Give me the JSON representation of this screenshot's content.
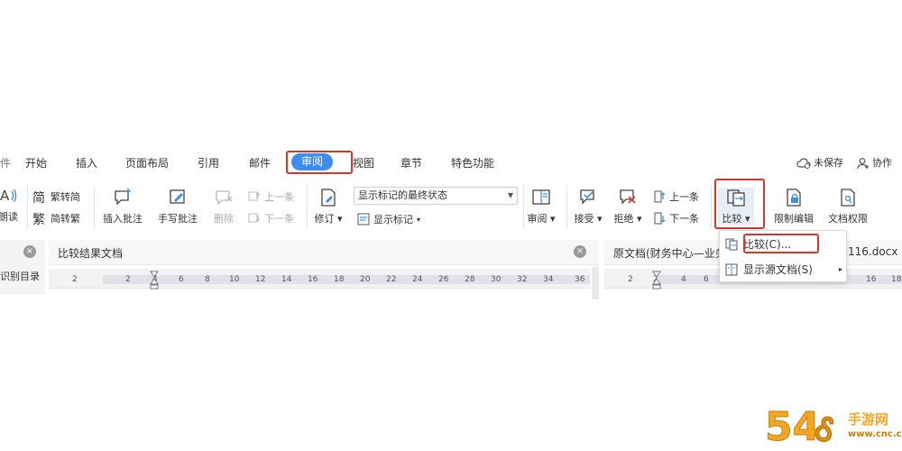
{
  "menubar": {
    "left_glyph": "件",
    "tabs": [
      "开始",
      "插入",
      "页面布局",
      "引用",
      "邮件",
      "审阅",
      "视图",
      "章节",
      "特色功能"
    ],
    "active_tab": "审阅",
    "unsaved": "未保存",
    "collaborate": "协作"
  },
  "ribbon": {
    "read_aloud": "朗读",
    "trad_to_simp": "繁转简",
    "simp_to_trad": "简转繁",
    "insert_comment": "插入批注",
    "handwrite_comment": "手写批注",
    "delete": "删除",
    "prev_item": "上一条",
    "next_item": "下一条",
    "revise": "修订",
    "markup_state": "显示标记的最终状态",
    "show_markup": "显示标记",
    "review": "审阅",
    "accept": "接受",
    "reject": "拒绝",
    "prev_change": "上一条",
    "next_change": "下一条",
    "compare": "比较",
    "restrict_edit": "限制编辑",
    "doc_permission": "文档权限"
  },
  "left_pane": {
    "label": "识别目录"
  },
  "middle_pane": {
    "title": "比较结果文档",
    "ruler_ticks": [
      "2",
      "2",
      "4",
      "6",
      "8",
      "10",
      "12",
      "14",
      "16",
      "18",
      "20",
      "22",
      "24",
      "26",
      "28",
      "30",
      "32",
      "34",
      "36"
    ]
  },
  "right_pane": {
    "title": "原文档(财务中心—业务",
    "title_suffix": "116.docx –",
    "ruler_ticks": [
      "2",
      "2",
      "4",
      "6",
      "8",
      "16",
      "18"
    ]
  },
  "dropdown": {
    "compare_item": "比较(C)...",
    "show_source": "显示源文档(S)"
  },
  "colors": {
    "accent": "#3b8df0",
    "highlight": "#d9362b",
    "watermark_orange": "#f5a623"
  },
  "watermark": {
    "brand": "手游网",
    "url": "www.cnc.cn"
  }
}
